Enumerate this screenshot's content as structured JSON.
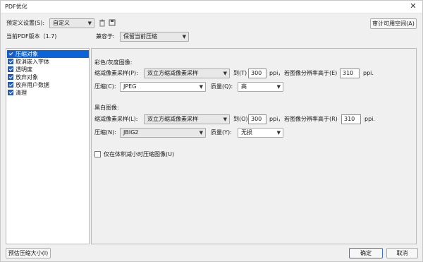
{
  "window": {
    "title": "PDF优化",
    "close": "✕"
  },
  "top": {
    "preset_label": "预定义设置(S):",
    "preset_value": "自定义",
    "delete_icon": "trash-icon",
    "save_icon": "save-icon",
    "audit_button": "审计可用空间(A)",
    "version_label": "当前PDF版本（1.7)",
    "compat_label": "兼容于:",
    "compat_value": "保留当前压缩"
  },
  "sidebar": {
    "items": [
      {
        "label": "压缩对象",
        "checked": true,
        "selected": true
      },
      {
        "label": "取消嵌入字体",
        "checked": true
      },
      {
        "label": "透明度",
        "checked": true
      },
      {
        "label": "放弃对象",
        "checked": true
      },
      {
        "label": "放弃用户数据",
        "checked": true
      },
      {
        "label": "清理",
        "checked": true
      }
    ]
  },
  "color": {
    "heading": "彩色/灰度图像:",
    "downsample_label": "缩减像素采样(P):",
    "downsample_value": "双立方缩减像素采样",
    "to_label": "到(T)",
    "to_value": "300",
    "ppi1": "ppi，",
    "above_label": "若图像分辨率高于(E)",
    "above_value": "310",
    "ppi2": "ppi.",
    "compression_label": "压缩(C):",
    "compression_value": "JPEG",
    "quality_label": "质量(Q):",
    "quality_value": "高"
  },
  "mono": {
    "heading": "黑白图像:",
    "downsample_label": "缩减像素采样(L):",
    "downsample_value": "双立方缩减像素采样",
    "to_label": "到(O)",
    "to_value": "300",
    "ppi1": "ppi，",
    "above_label": "若图像分辨率高于(R)",
    "above_value": "310",
    "ppi2": "ppi.",
    "compression_label": "压缩(N):",
    "compression_value": "JBIG2",
    "quality_label": "质量(Y):",
    "quality_value": "无损"
  },
  "option": {
    "label": "仅在体积减小时压缩图像(U)",
    "checked": false
  },
  "bottom": {
    "estimate": "预估压缩大小(I)",
    "ok": "确定",
    "cancel": "取消"
  },
  "colors": {
    "accent": "#0a64d8",
    "checkbox": "#2a62c9"
  }
}
